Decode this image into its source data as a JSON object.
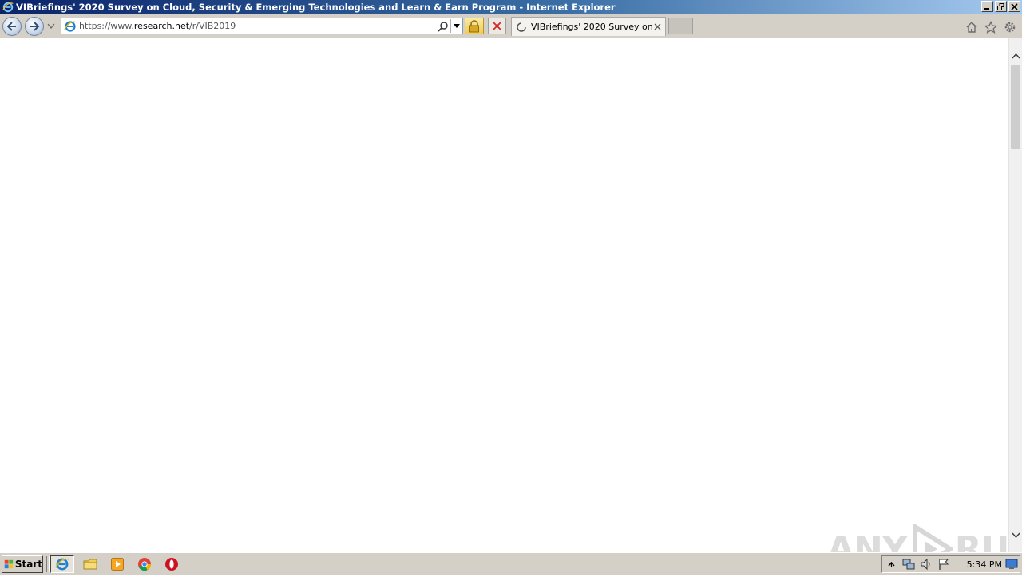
{
  "window": {
    "title": "VIBriefings' 2020 Survey on Cloud, Security & Emerging Technologies and Learn & Earn Program - Internet Explorer",
    "controls": [
      "minimize",
      "restore",
      "close"
    ]
  },
  "navbar": {
    "url_prefix": "https://www.",
    "url_domain": "research.net",
    "url_path": "/r/VIB2019",
    "tab_label": "VIBriefings' 2020 Survey on ..."
  },
  "content": {
    "watermark_left": "ANY",
    "watermark_right": "RUN"
  },
  "taskbar": {
    "start_label": "Start",
    "clock": "5:34 PM",
    "apps": [
      "internet-explorer",
      "windows-explorer",
      "media-player",
      "chrome",
      "opera"
    ]
  },
  "colors": {
    "titlebar_start": "#0a246a",
    "chrome_gray": "#d4d0c8",
    "close_red": "#cc2222"
  }
}
